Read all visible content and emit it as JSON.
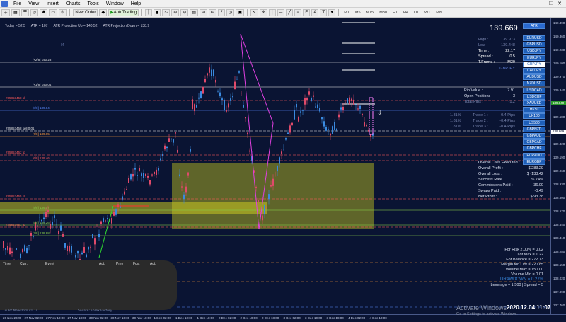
{
  "menu": [
    "File",
    "View",
    "Insert",
    "Charts",
    "Tools",
    "Window",
    "Help"
  ],
  "toolbar": {
    "new_order": "New Order",
    "autotrading": "AutoTrading",
    "timeframes": [
      "M1",
      "M5",
      "M15",
      "M30",
      "H1",
      "H4",
      "D1",
      "W1",
      "MN"
    ]
  },
  "info": {
    "today": "Today = 52.5",
    "atr": "ATR = 107",
    "up": "ATR Projection Up = 140.52",
    "down": "ATR Projection Down = 138.9",
    "marker": "M"
  },
  "levels": [
    {
      "label": "[+2/8]  140.23",
      "color": "#e0e0e0"
    },
    {
      "label": "[+1/8]  140.04",
      "color": "#e0e0e0"
    },
    {
      "label": "#35853458 sl",
      "color": "#ff5a5a"
    },
    {
      "label": "[8/8]  139.84",
      "color": "#5a8aff"
    },
    {
      "label": "#35853458 sell 0.01",
      "color": "#e0e0e0"
    },
    {
      "label": "[7/8]  139.65",
      "color": "#ff9a3a"
    },
    {
      "label": "#35853452 tp",
      "color": "#ff5a5a"
    },
    {
      "label": "[6/8]  139.46",
      "color": "#ff5a5a"
    },
    {
      "label": "[5/8]  139.26",
      "color": "#8ad04a"
    },
    {
      "label": "#35853455 sl",
      "color": "#ff5a5a"
    },
    {
      "label": "[4/8]  139.07",
      "color": "#8ad04a"
    },
    {
      "label": "#35853451 tp",
      "color": "#ff5a5a"
    },
    {
      "label": "[3/8]  138.88",
      "color": "#8ad04a"
    }
  ],
  "price_axis": [
    "140.490",
    "140.360",
    "140.230",
    "140.100",
    "139.970",
    "139.840",
    "139.710",
    "139.580",
    "139.450",
    "139.320",
    "139.190",
    "139.060",
    "138.930",
    "138.800",
    "138.670",
    "138.540",
    "138.410",
    "138.280",
    "138.150",
    "138.020",
    "137.890",
    "137.760"
  ],
  "price_tags": [
    {
      "text": "139.840",
      "color": "#2a9a2a"
    },
    {
      "text": "139.669",
      "color": "#ffffff"
    }
  ],
  "time_axis": [
    "26 Nov 2020",
    "27 Nov 02:00",
    "27 Nov 10:00",
    "27 Nov 18:00",
    "30 Nov 02:00",
    "30 Nov 10:00",
    "30 Nov 18:00",
    "1 Dec 02:00",
    "1 Dec 10:00",
    "1 Dec 18:00",
    "2 Dec 02:00",
    "2 Dec 10:00",
    "2 Dec 18:00",
    "3 Dec 02:00",
    "3 Dec 10:00",
    "3 Dec 18:00",
    "4 Dec 02:00",
    "4 Dec 10:00"
  ],
  "panel": {
    "price": "139.669",
    "atr_btn": "ATR",
    "high_label": "High :",
    "high": "139.973",
    "low_label": "Low :",
    "low": "139.448",
    "time_label": "Time :",
    "time": "22:17",
    "spread_label": "Spread :",
    "spread": "0.5",
    "tf_label": "T.Frame :",
    "tf": "M30",
    "symbol": "GBPJPY",
    "pip_label": "Pip Value :",
    "pip": "7.91",
    "open_label": "Open Positions :",
    "open": "3",
    "total_label": "Total Pips :",
    "total": "-1.2",
    "trades": [
      {
        "pct": "1.81%",
        "name": "Trade 1 :",
        "val": "-0.4 Pips"
      },
      {
        "pct": "1.81%",
        "name": "Trade 2 :",
        "val": "-0.4 Pips"
      },
      {
        "pct": "1.81%",
        "name": "Trade 3 :",
        "val": "-0.4 Pips"
      }
    ],
    "stats": [
      {
        "k": "Overall Calls Executed :",
        "v": "145"
      },
      {
        "k": "Overall Profit :",
        "v": "$ 283.29"
      },
      {
        "k": "Overall Loss :",
        "v": "$ -133.42"
      },
      {
        "k": "Success Rate :",
        "v": "76.74%"
      },
      {
        "k": "Commissions Paid :",
        "v": "-36.00"
      },
      {
        "k": "Swaps Paid :",
        "v": "-0.49"
      },
      {
        "k": "Net Profit :",
        "v": "$ 93.38"
      }
    ],
    "risk": [
      "For Risk 2.00% = 0.02",
      "Lot Max = 1.22",
      "For Balance = 272.73",
      "Margin for 1 lot = 220.85",
      "Volume Max = 150.00",
      "Volume Min = 0.01"
    ],
    "drawdown": "DRAWDOWN = 0.27%",
    "leverage": "Leverage = 1:500 | Spread = 5"
  },
  "symbols": [
    "EURUSD",
    "GBPUSD",
    "USDJPY",
    "EURJPY",
    "GBPJPY",
    "CADJPY",
    "AUDUSD",
    "NZDUSD",
    "USDCAD",
    "USDCHF",
    "XAUUSD",
    "HK50",
    "UK100",
    "US500",
    "GBPNZD",
    "GBPAUD",
    "GBPCAD",
    "GBPCHF",
    "EURAUD",
    "EURGBP"
  ],
  "selected_symbol": "GBPJPY",
  "news": {
    "headers": [
      "Time",
      "Curr.",
      "Event",
      "Act.",
      "Prev",
      "Fcst",
      "Act."
    ],
    "footer_left": "ZuPY NewsInfo v1.14",
    "footer_mid": "Source: Forex Factory"
  },
  "windows": {
    "activate": "Activate Windows",
    "activate_sub": "Go to Settings to activate Windows."
  },
  "clock": "2020.12.04 11:07",
  "colors": {
    "bg": "#0a1433",
    "bull": "#3a8ae0",
    "bear": "#e04a6a",
    "magenta": "#e040e0",
    "zone": "#c8c820"
  }
}
